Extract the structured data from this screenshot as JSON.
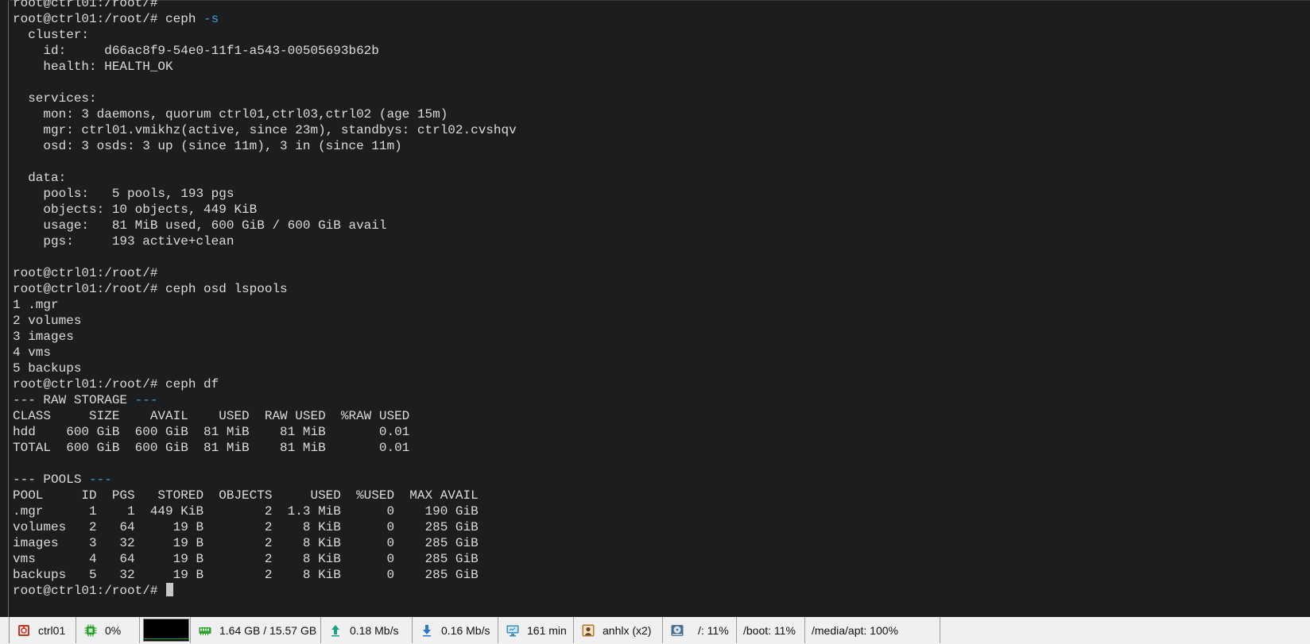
{
  "terminal": {
    "prompt": "root@ctrl01:/root/#",
    "lines": [
      {
        "text": "root@ctrl01:/root/#"
      },
      {
        "text": "root@ctrl01:/root/# ceph ",
        "accent": "-s"
      },
      {
        "text": "  cluster:"
      },
      {
        "text": "    id:     d66ac8f9-54e0-11f1-a543-00505693b62b"
      },
      {
        "text": "    health: HEALTH_OK"
      },
      {
        "text": ""
      },
      {
        "text": "  services:"
      },
      {
        "text": "    mon: 3 daemons, quorum ctrl01,ctrl03,ctrl02 (age 15m)"
      },
      {
        "text": "    mgr: ctrl01.vmikhz(active, since 23m), standbys: ctrl02.cvshqv"
      },
      {
        "text": "    osd: 3 osds: 3 up (since 11m), 3 in (since 11m)"
      },
      {
        "text": ""
      },
      {
        "text": "  data:"
      },
      {
        "text": "    pools:   5 pools, 193 pgs"
      },
      {
        "text": "    objects: 10 objects, 449 KiB"
      },
      {
        "text": "    usage:   81 MiB used, 600 GiB / 600 GiB avail"
      },
      {
        "text": "    pgs:     193 active+clean"
      },
      {
        "text": ""
      },
      {
        "text": "root@ctrl01:/root/#"
      },
      {
        "text": "root@ctrl01:/root/# ceph osd lspools"
      },
      {
        "text": "1 .mgr"
      },
      {
        "text": "2 volumes"
      },
      {
        "text": "3 images"
      },
      {
        "text": "4 vms"
      },
      {
        "text": "5 backups"
      },
      {
        "text": "root@ctrl01:/root/# ceph df"
      },
      {
        "text": "--- RAW STORAGE ",
        "accent": "---"
      },
      {
        "text": "CLASS     SIZE    AVAIL    USED  RAW USED  %RAW USED"
      },
      {
        "text": "hdd    600 GiB  600 GiB  81 MiB    81 MiB       0.01"
      },
      {
        "text": "TOTAL  600 GiB  600 GiB  81 MiB    81 MiB       0.01"
      },
      {
        "text": ""
      },
      {
        "text": "--- POOLS ",
        "accent": "---"
      },
      {
        "text": "POOL     ID  PGS   STORED  OBJECTS     USED  %USED  MAX AVAIL"
      },
      {
        "text": ".mgr      1    1  449 KiB        2  1.3 MiB      0    190 GiB"
      },
      {
        "text": "volumes   2   64     19 B        2    8 KiB      0    285 GiB"
      },
      {
        "text": "images    3   32     19 B        2    8 KiB      0    285 GiB"
      },
      {
        "text": "vms       4   64     19 B        2    8 KiB      0    285 GiB"
      },
      {
        "text": "backups   5   32     19 B        2    8 KiB      0    285 GiB"
      },
      {
        "text": "root@ctrl01:/root/# ",
        "cursor": true
      }
    ]
  },
  "statusbar": {
    "host": {
      "label": "ctrl01",
      "icon": "server-icon"
    },
    "cpu": {
      "label": "0%",
      "icon": "cpu-chip-icon",
      "graph_level": 0.02
    },
    "memory": {
      "label": "1.64 GB / 15.57 GB",
      "icon": "memory-icon"
    },
    "upload": {
      "label": "0.18 Mb/s",
      "icon": "upload-arrow-icon"
    },
    "download": {
      "label": "0.16 Mb/s",
      "icon": "download-arrow-icon"
    },
    "uptime": {
      "label": "161 min",
      "icon": "monitor-icon"
    },
    "users": {
      "label": "anhlx (x2)",
      "icon": "user-icon"
    },
    "disk_root": {
      "label": "/: 11%",
      "icon": "disk-icon"
    },
    "disk_boot": {
      "label": "/boot: 11%"
    },
    "disk_media": {
      "label": "/media/apt: 100%"
    }
  },
  "colors": {
    "terminal_bg": "#1b1d1e",
    "terminal_fg": "#dcdcdc",
    "accent": "#3fa3d6",
    "statusbar_bg": "#f0f0f0"
  }
}
